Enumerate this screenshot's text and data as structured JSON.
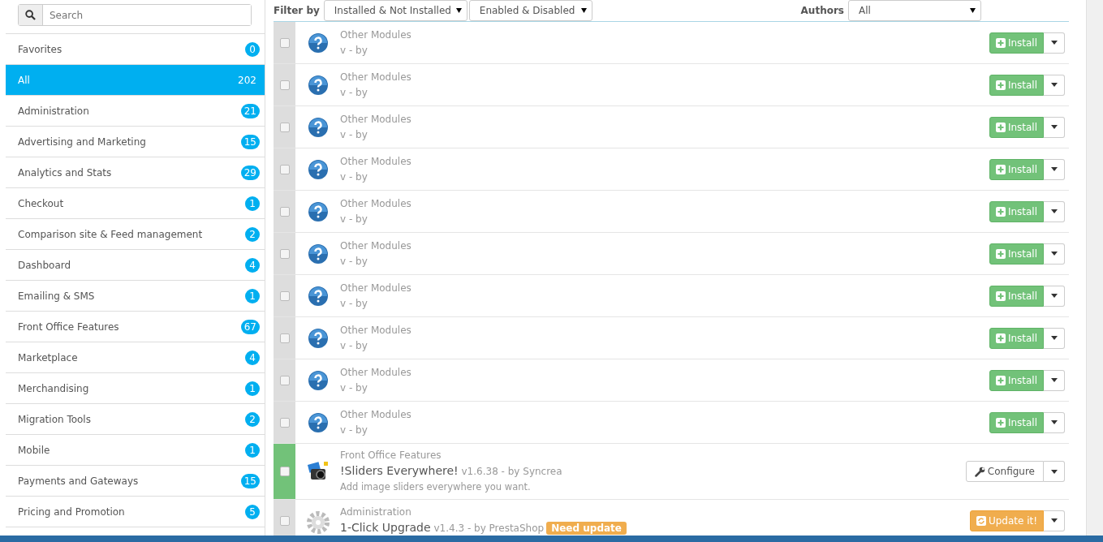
{
  "search": {
    "placeholder": "Search"
  },
  "categories": [
    {
      "label": "Favorites",
      "count": "0",
      "selected": false
    },
    {
      "label": "All",
      "count": "202",
      "selected": true
    },
    {
      "label": "Administration",
      "count": "21",
      "selected": false
    },
    {
      "label": "Advertising and Marketing",
      "count": "15",
      "selected": false
    },
    {
      "label": "Analytics and Stats",
      "count": "29",
      "selected": false
    },
    {
      "label": "Checkout",
      "count": "1",
      "selected": false
    },
    {
      "label": "Comparison site & Feed management",
      "count": "2",
      "selected": false
    },
    {
      "label": "Dashboard",
      "count": "4",
      "selected": false
    },
    {
      "label": "Emailing & SMS",
      "count": "1",
      "selected": false
    },
    {
      "label": "Front Office Features",
      "count": "67",
      "selected": false
    },
    {
      "label": "Marketplace",
      "count": "4",
      "selected": false
    },
    {
      "label": "Merchandising",
      "count": "1",
      "selected": false
    },
    {
      "label": "Migration Tools",
      "count": "2",
      "selected": false
    },
    {
      "label": "Mobile",
      "count": "1",
      "selected": false
    },
    {
      "label": "Payments and Gateways",
      "count": "15",
      "selected": false
    },
    {
      "label": "Pricing and Promotion",
      "count": "5",
      "selected": false
    }
  ],
  "filters": {
    "label": "Filter by",
    "status": "Installed & Not Installed",
    "enabled": "Enabled & Disabled",
    "authors_label": "Authors",
    "authors": "All"
  },
  "modules": [
    {
      "category": "Other Modules",
      "meta": "v - by",
      "enabled": false,
      "kind": "not_installed",
      "button": "Install"
    },
    {
      "category": "Other Modules",
      "meta": "v - by",
      "enabled": false,
      "kind": "not_installed",
      "button": "Install"
    },
    {
      "category": "Other Modules",
      "meta": "v - by",
      "enabled": false,
      "kind": "not_installed",
      "button": "Install"
    },
    {
      "category": "Other Modules",
      "meta": "v - by",
      "enabled": false,
      "kind": "not_installed",
      "button": "Install"
    },
    {
      "category": "Other Modules",
      "meta": "v - by",
      "enabled": false,
      "kind": "not_installed",
      "button": "Install"
    },
    {
      "category": "Other Modules",
      "meta": "v - by",
      "enabled": false,
      "kind": "not_installed",
      "button": "Install"
    },
    {
      "category": "Other Modules",
      "meta": "v - by",
      "enabled": false,
      "kind": "not_installed",
      "button": "Install"
    },
    {
      "category": "Other Modules",
      "meta": "v - by",
      "enabled": false,
      "kind": "not_installed",
      "button": "Install"
    },
    {
      "category": "Other Modules",
      "meta": "v - by",
      "enabled": false,
      "kind": "not_installed",
      "button": "Install"
    },
    {
      "category": "Other Modules",
      "meta": "v - by",
      "enabled": false,
      "kind": "not_installed",
      "button": "Install"
    },
    {
      "category": "Front Office Features",
      "name": "!Sliders Everywhere!",
      "meta": "v1.6.38 - by Syncrea",
      "description": "Add image sliders everywhere you want.",
      "enabled": true,
      "kind": "configurable",
      "button": "Configure"
    },
    {
      "category": "Administration",
      "name": "1-Click Upgrade",
      "meta": "v1.4.3 - by PrestaShop",
      "badge": "Need update",
      "enabled": false,
      "kind": "upgradable",
      "button": "Update it!"
    }
  ]
}
